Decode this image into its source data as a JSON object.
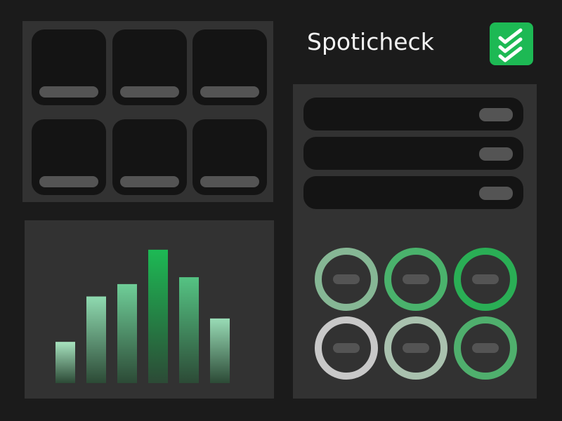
{
  "header": {
    "title": "Spoticheck",
    "icon": "double-check-icon",
    "accent_color": "#1db954"
  },
  "tiles": {
    "count": 6
  },
  "chart_data": {
    "type": "bar",
    "categories": [],
    "values": [
      30,
      63,
      72,
      97,
      77,
      47
    ],
    "ylim": [
      0,
      100
    ],
    "colors_top": [
      "#a8e4c0",
      "#8fdab0",
      "#6fce98",
      "#1db954",
      "#55c383",
      "#99dcb6"
    ]
  },
  "list": {
    "rows": 3,
    "rings": [
      {
        "color": "#86b795"
      },
      {
        "color": "#4ab26c"
      },
      {
        "color": "#2aae55"
      },
      {
        "color": "#c8c8c8"
      },
      {
        "color": "#a9c1ae"
      },
      {
        "color": "#4faf6d"
      }
    ]
  }
}
